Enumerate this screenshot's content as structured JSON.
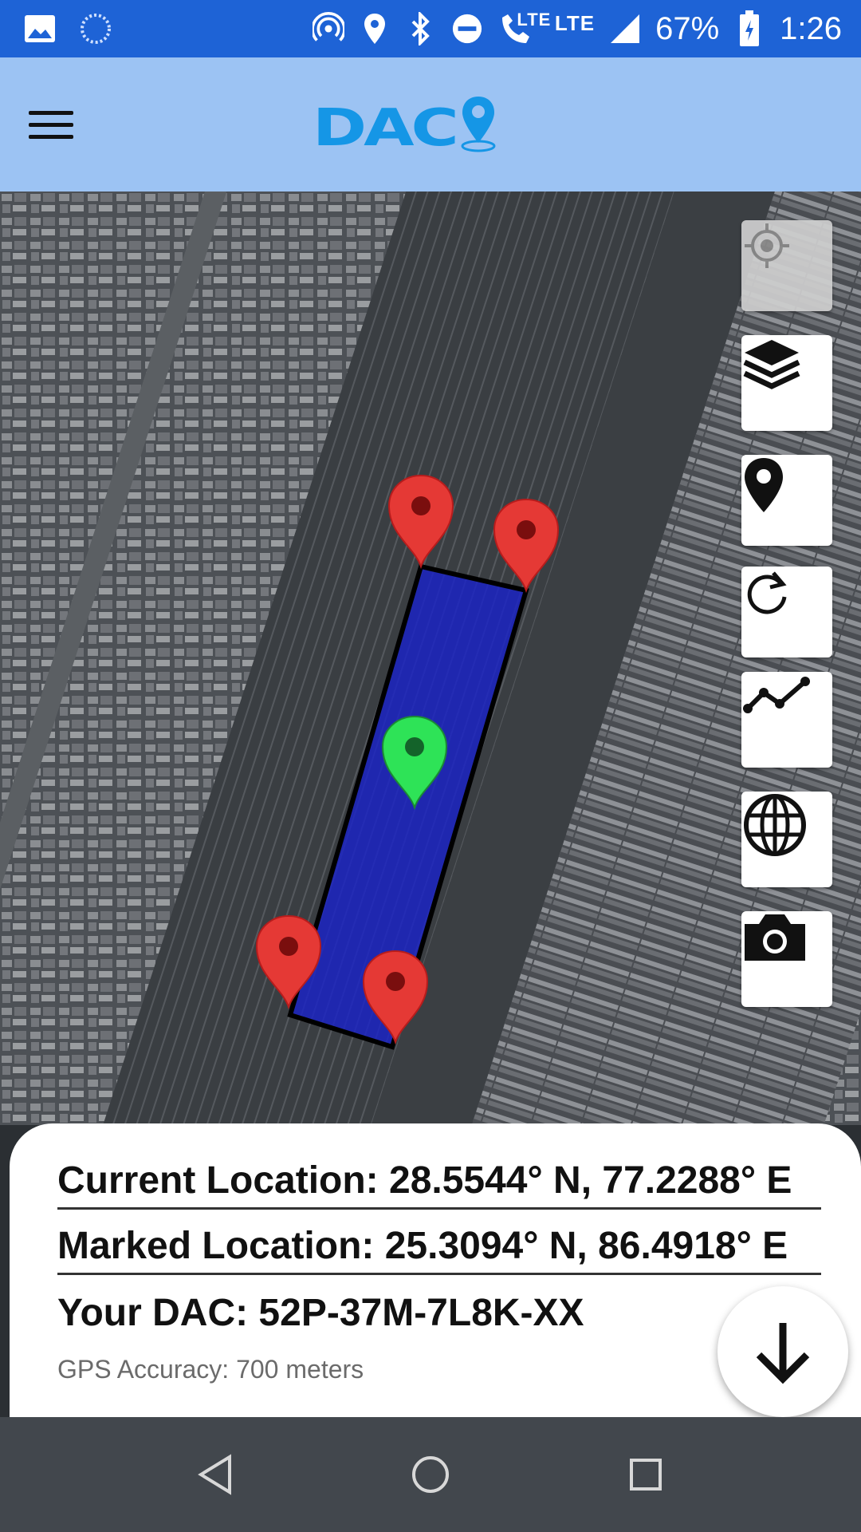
{
  "status_bar": {
    "battery": "67%",
    "time": "1:26",
    "network_1": "LTE",
    "network_2": "LTE"
  },
  "header": {
    "logo_text": "DAC"
  },
  "map": {
    "controls": [
      {
        "name": "my-location",
        "icon": "crosshair-icon",
        "enabled": false
      },
      {
        "name": "layers",
        "icon": "layers-icon"
      },
      {
        "name": "place-marker",
        "icon": "map-pin-icon"
      },
      {
        "name": "refresh",
        "icon": "refresh-icon"
      },
      {
        "name": "trace-path",
        "icon": "polyline-icon"
      },
      {
        "name": "globe",
        "icon": "globe-icon"
      },
      {
        "name": "camera",
        "icon": "camera-icon"
      }
    ],
    "polygon_color": "#1a22c7",
    "marker_red": "#e53935",
    "marker_green": "#2ee357"
  },
  "info": {
    "current_location": "Current Location: 28.5544° N, 77.2288° E",
    "marked_location": "Marked Location: 25.3094° N, 86.4918° E",
    "dac": "Your DAC: 52P-37M-7L8K-XX",
    "gps_accuracy": "GPS Accuracy: 700 meters"
  },
  "nav": {
    "buttons": [
      "back",
      "home",
      "recents"
    ]
  }
}
